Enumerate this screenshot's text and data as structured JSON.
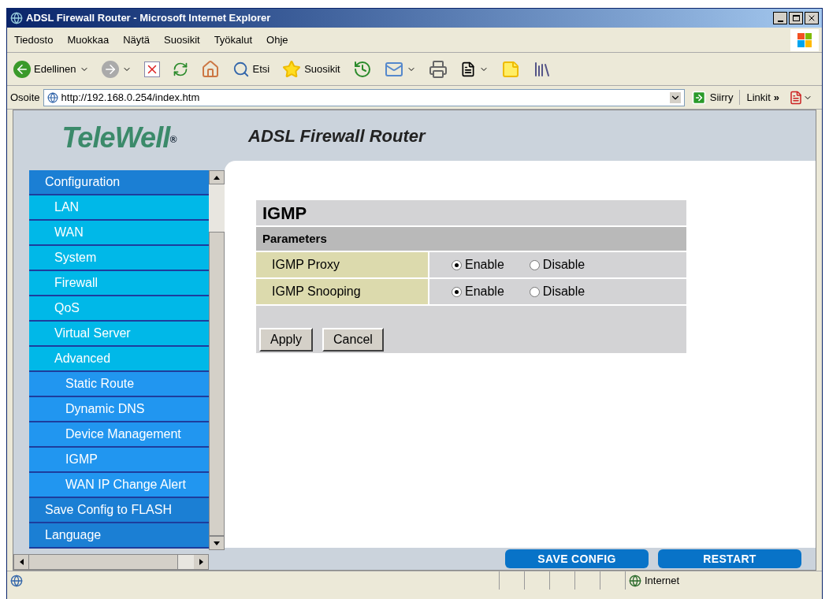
{
  "window": {
    "title": "ADSL Firewall Router - Microsoft Internet Explorer"
  },
  "menu": [
    "Tiedosto",
    "Muokkaa",
    "Näytä",
    "Suosikit",
    "Työkalut",
    "Ohje"
  ],
  "toolbar": {
    "back": "Edellinen",
    "search": "Etsi",
    "favorites": "Suosikit"
  },
  "address": {
    "label": "Osoite",
    "url": "http://192.168.0.254/index.htm",
    "go": "Siirry",
    "links": "Linkit",
    "chevron": "»"
  },
  "page": {
    "logo": "TeleWell",
    "logo_mark": "®",
    "header": "ADSL Firewall Router",
    "sidebar": [
      {
        "label": "Configuration",
        "kind": "section"
      },
      {
        "label": "LAN",
        "kind": "item"
      },
      {
        "label": "WAN",
        "kind": "item"
      },
      {
        "label": "System",
        "kind": "item"
      },
      {
        "label": "Firewall",
        "kind": "item"
      },
      {
        "label": "QoS",
        "kind": "item"
      },
      {
        "label": "Virtual Server",
        "kind": "item"
      },
      {
        "label": "Advanced",
        "kind": "item"
      },
      {
        "label": "Static Route",
        "kind": "subitem"
      },
      {
        "label": "Dynamic DNS",
        "kind": "subitem"
      },
      {
        "label": "Device Management",
        "kind": "subitem"
      },
      {
        "label": "IGMP",
        "kind": "subitem"
      },
      {
        "label": "WAN IP Change Alert",
        "kind": "subitem"
      },
      {
        "label": "Save Config to FLASH",
        "kind": "section"
      },
      {
        "label": "Language",
        "kind": "section"
      }
    ],
    "panel": {
      "title": "IGMP",
      "section": "Parameters",
      "rows": [
        {
          "label": "IGMP Proxy",
          "options": [
            {
              "label": "Enable",
              "selected": true
            },
            {
              "label": "Disable",
              "selected": false
            }
          ]
        },
        {
          "label": "IGMP Snooping",
          "options": [
            {
              "label": "Enable",
              "selected": true
            },
            {
              "label": "Disable",
              "selected": false
            }
          ]
        }
      ],
      "buttons": [
        "Apply",
        "Cancel"
      ]
    },
    "footer_buttons": [
      "SAVE CONFIG",
      "RESTART"
    ]
  },
  "status_bar": {
    "zone": "Internet"
  }
}
